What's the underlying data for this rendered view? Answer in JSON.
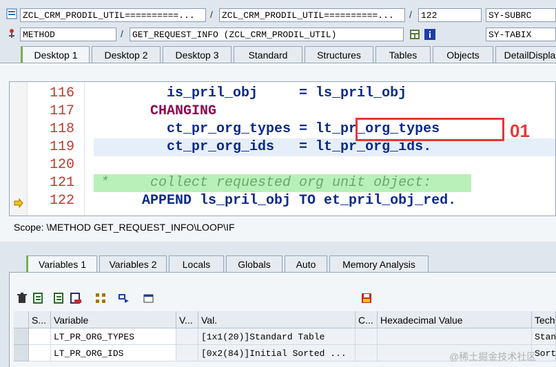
{
  "header": {
    "program_1": "ZCL_CRM_PRODIL_UTIL==========...",
    "program_2": "ZCL_CRM_PRODIL_UTIL==========...",
    "line_number": "122",
    "sysfield_1": "SY-SUBRC",
    "event_type": "METHOD",
    "event_name": "GET_REQUEST_INFO (ZCL_CRM_PRODIL_UTIL)",
    "sysfield_2": "SY-TABIX",
    "sep": "/"
  },
  "desktop_tabs": [
    "Desktop 1",
    "Desktop 2",
    "Desktop 3",
    "Standard",
    "Structures",
    "Tables",
    "Objects",
    "DetailDispla"
  ],
  "editor": {
    "lines": [
      {
        "num": "116",
        "text": "        is_pril_obj     = ls_pril_obj"
      },
      {
        "num": "117",
        "text": "      CHANGING"
      },
      {
        "num": "118",
        "text": "        ct_pr_org_types = lt_pr_org_types"
      },
      {
        "num": "119",
        "text": "        ct_pr_org_ids   = lt_pr_org_ids."
      },
      {
        "num": "120",
        "text": ""
      },
      {
        "num": "121",
        "text": "*     collect requested org unit object:"
      },
      {
        "num": "122",
        "text": "     APPEND ls_pril_obj TO et_pril_obj_red."
      }
    ],
    "annotation": "01"
  },
  "scope": "Scope: \\METHOD GET_REQUEST_INFO\\LOOP\\IF",
  "var_tabs": [
    "Variables 1",
    "Variables 2",
    "Locals",
    "Globals",
    "Auto",
    "Memory Analysis"
  ],
  "table": {
    "columns": [
      "S...",
      "Variable",
      "V...",
      "Val.",
      "C...",
      "Hexadecimal Value",
      "Tech"
    ],
    "rows": [
      {
        "variable": "LT_PR_ORG_TYPES",
        "value": "[1x1(20)]Standard Table",
        "tech": "Stand"
      },
      {
        "variable": "LT_PR_ORG_IDS",
        "value": "[0x2(84)]Initial Sorted ...",
        "tech": "Sorte"
      }
    ]
  },
  "watermark": "@稀土掘金技术社区"
}
